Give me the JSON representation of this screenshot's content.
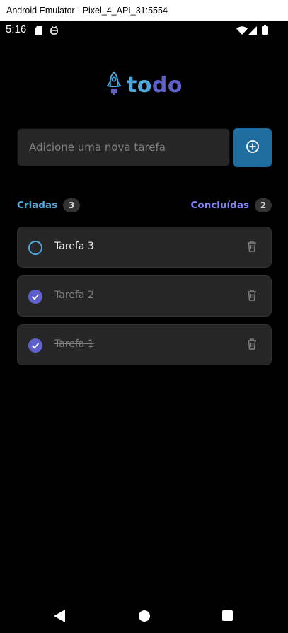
{
  "window": {
    "title": "Android Emulator - Pixel_4_API_31:5554"
  },
  "status_bar": {
    "time": "5:16",
    "icons": [
      "sd-card-icon",
      "debug-icon",
      "wifi-icon",
      "signal-icon",
      "battery-icon"
    ]
  },
  "logo": {
    "part1": "to",
    "part2": "do",
    "icon": "rocket-icon"
  },
  "colors": {
    "accent_blue": "#4ea8de",
    "accent_purple": "#5e60ce",
    "purple_light": "#8284fa",
    "button_blue": "#1e6f9f"
  },
  "new_task": {
    "placeholder": "Adicione uma nova tarefa",
    "value": "",
    "add_icon": "plus-circle-icon"
  },
  "counters": {
    "created_label": "Criadas",
    "created_count": "3",
    "done_label": "Concluídas",
    "done_count": "2"
  },
  "tasks": [
    {
      "title": "Tarefa 3",
      "done": false
    },
    {
      "title": "Tarefa 2",
      "done": true
    },
    {
      "title": "Tarefa 1",
      "done": true
    }
  ],
  "nav": [
    "back-icon",
    "home-icon",
    "recents-icon"
  ]
}
